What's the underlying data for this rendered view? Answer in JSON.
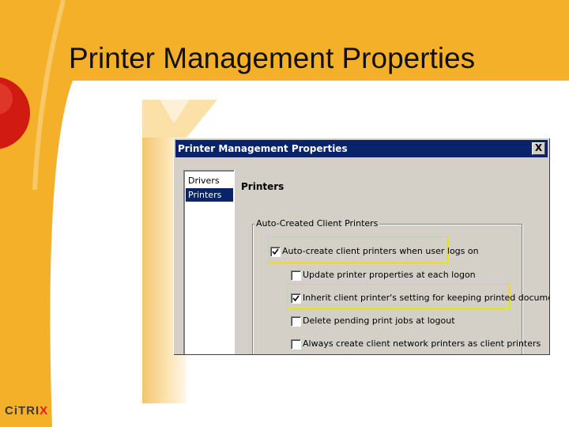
{
  "slide": {
    "title": "Printer Management Properties",
    "brand": {
      "name_prefix": "CiTRI",
      "name_suffix": "X",
      "accent_color": "#e0201b"
    },
    "colors": {
      "orange": "#f5b02a",
      "red_dot": "#d11a12"
    }
  },
  "dialog": {
    "title": "Printer Management Properties",
    "close_label": "X",
    "nav": [
      {
        "label": "Drivers",
        "selected": false
      },
      {
        "label": "Printers",
        "selected": true
      }
    ],
    "panel_title": "Printers",
    "group_label": "Auto-Created Client Printers",
    "options": [
      {
        "label": "Auto-create client printers when user logs on",
        "checked": true,
        "highlighted": true
      },
      {
        "label": "Update printer properties at each logon",
        "checked": false,
        "highlighted": false
      },
      {
        "label": "Inherit client printer's setting for keeping printed documents.",
        "checked": true,
        "highlighted": true
      },
      {
        "label": "Delete pending print jobs at logout",
        "checked": false,
        "highlighted": false
      },
      {
        "label": "Always create client network printers as client printers",
        "checked": false,
        "highlighted": false
      }
    ]
  }
}
